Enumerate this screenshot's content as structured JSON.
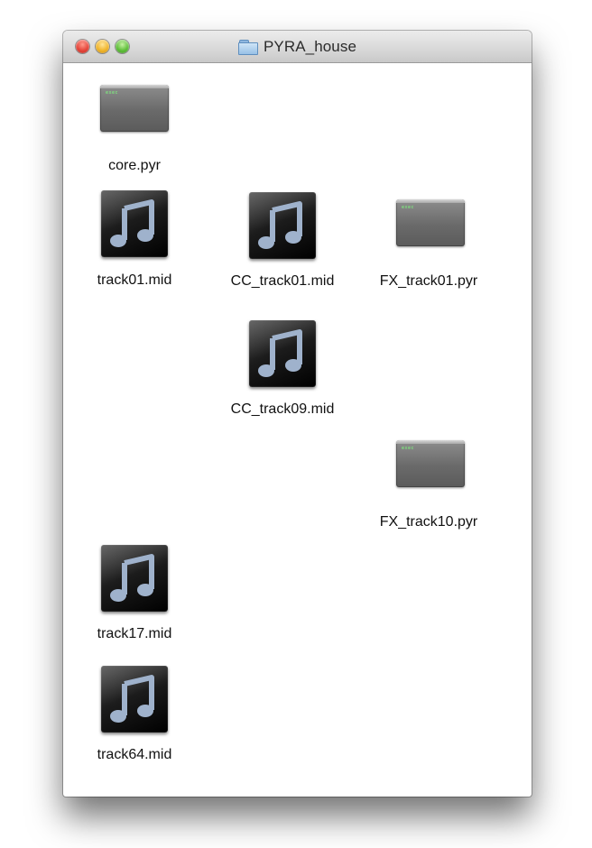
{
  "window": {
    "title": "PYRA_house",
    "folder_icon": "folder-icon",
    "buttons": [
      "close",
      "minimize",
      "zoom"
    ]
  },
  "files": [
    {
      "name": "core.pyr",
      "icon": "exec-icon"
    },
    {
      "name": "track01.mid",
      "icon": "midi-icon"
    },
    {
      "name": "CC_track01.mid",
      "icon": "midi-icon"
    },
    {
      "name": "FX_track01.pyr",
      "icon": "exec-icon"
    },
    {
      "name": "CC_track09.mid",
      "icon": "midi-icon"
    },
    {
      "name": "FX_track10.pyr",
      "icon": "exec-icon"
    },
    {
      "name": "track17.mid",
      "icon": "midi-icon"
    },
    {
      "name": "track64.mid",
      "icon": "midi-icon"
    }
  ],
  "exec_prompt": "exec"
}
